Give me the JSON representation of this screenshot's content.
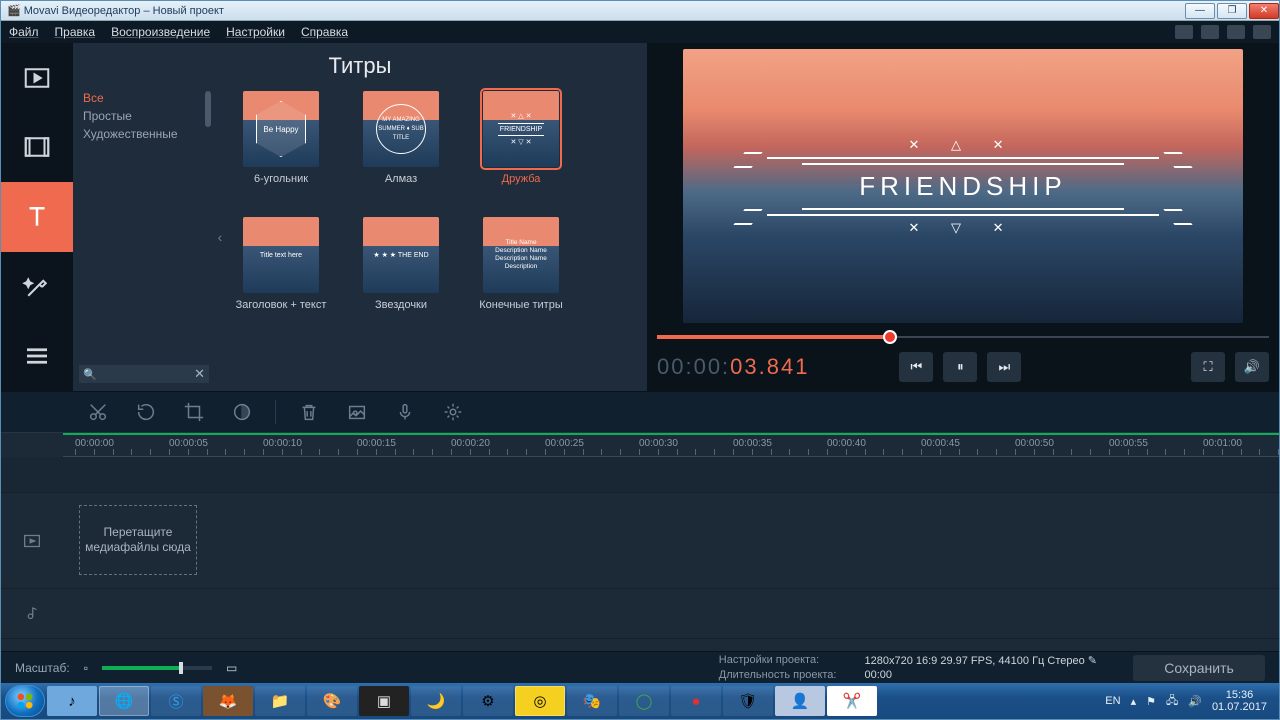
{
  "window": {
    "title": "Movavi Видеоредактор – Новый проект"
  },
  "menu": {
    "items": [
      "Файл",
      "Правка",
      "Воспроизведение",
      "Настройки",
      "Справка"
    ]
  },
  "rail": {
    "active_index": 2
  },
  "panel": {
    "title": "Титры",
    "categories": [
      "Все",
      "Простые",
      "Художественные"
    ],
    "selected_category": 0,
    "search_placeholder": "",
    "items": [
      {
        "label": "6-угольник",
        "thumb": "hex",
        "text": "Be\nHappy"
      },
      {
        "label": "Алмаз",
        "thumb": "diamond",
        "text": "MY AMAZING SUMMER\n♦\nSUB TITLE"
      },
      {
        "label": "Дружба",
        "thumb": "friend",
        "text": "FRIENDSHIP",
        "selected": true
      },
      {
        "label": "Заголовок + текст",
        "thumb": "plain",
        "text": "Title text\nhere"
      },
      {
        "label": "Звездочки",
        "thumb": "stars",
        "text": "★ ★ ★\nTHE END"
      },
      {
        "label": "Конечные титры",
        "thumb": "credits",
        "text": "Title\nName Description\nName Description\nName Description"
      }
    ]
  },
  "preview": {
    "overlay_title": "FRIENDSHIP",
    "timecode_gray": "00:00:",
    "timecode_orange": "03.841",
    "scrub_fraction": 0.38
  },
  "ruler": [
    "00:00:00",
    "00:00:05",
    "00:00:10",
    "00:00:15",
    "00:00:20",
    "00:00:25",
    "00:00:30",
    "00:00:35",
    "00:00:40",
    "00:00:45",
    "00:00:50",
    "00:00:55",
    "00:01:00"
  ],
  "drop_hint": "Перетащите медиафайлы сюда",
  "bottom": {
    "zoom_label": "Масштаб:",
    "settings_label": "Настройки проекта:",
    "settings_value": "1280x720 16:9 29.97 FPS, 44100 Гц Стерео",
    "duration_label": "Длительность проекта:",
    "duration_value": "00:00",
    "save": "Сохранить"
  },
  "tray": {
    "lang": "EN",
    "time": "15:36",
    "date": "01.07.2017"
  }
}
